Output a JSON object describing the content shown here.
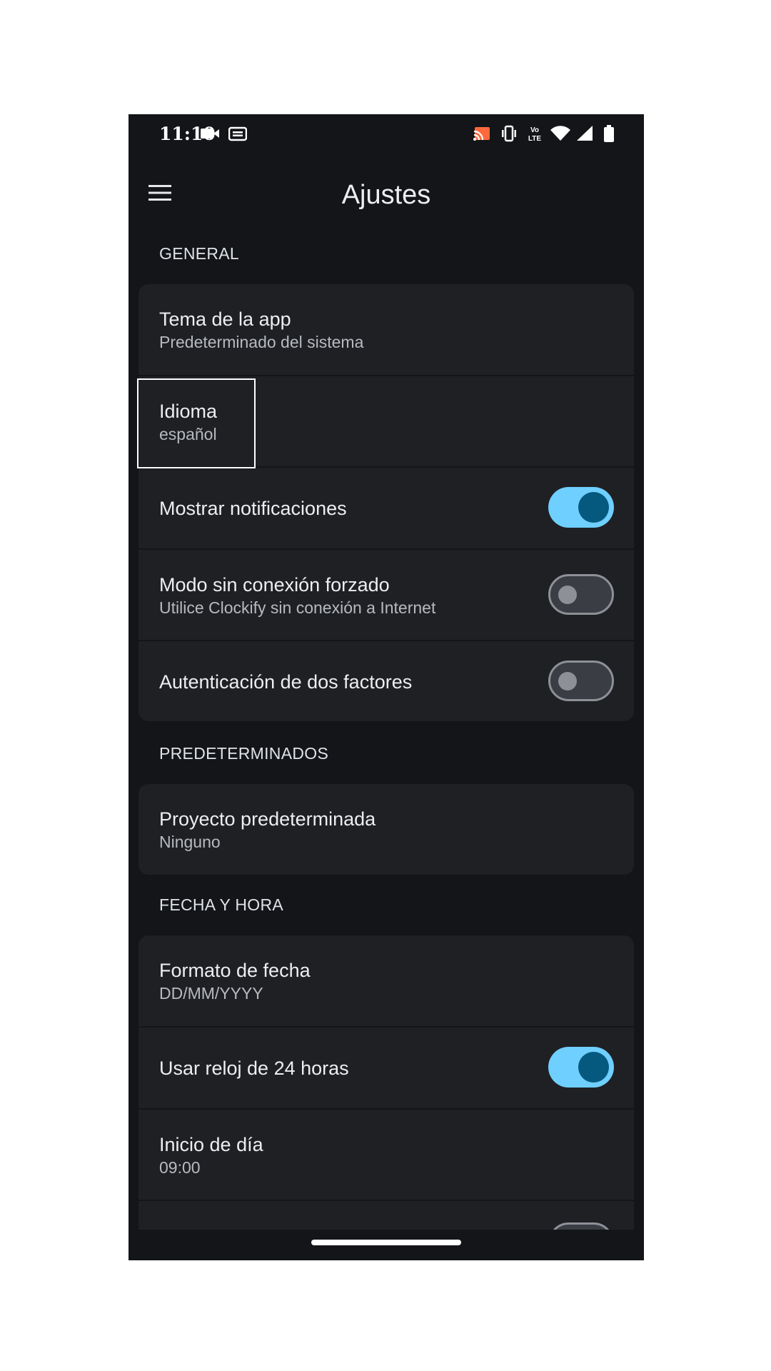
{
  "status_bar": {
    "time": "11:10",
    "icons_left": [
      "video-camera-icon",
      "gif-badge-icon"
    ],
    "icons_right": [
      "cast-icon",
      "vibrate-icon",
      "volte-icon",
      "wifi-icon",
      "cellular-signal-icon",
      "battery-icon"
    ],
    "volte_top": "Vo",
    "volte_bottom": "LTE"
  },
  "app_bar": {
    "menu_icon": "hamburger-menu-icon",
    "title": "Ajustes"
  },
  "sections": {
    "general": "GENERAL",
    "defaults": "PREDETERMINADOS",
    "datetime": "FECHA Y HORA"
  },
  "general": {
    "theme": {
      "title": "Tema de la app",
      "value": "Predeterminado del sistema"
    },
    "language": {
      "title": "Idioma",
      "value": "español"
    },
    "notifications": {
      "title": "Mostrar notificaciones",
      "enabled": true
    },
    "offline": {
      "title": "Modo sin conexión forzado",
      "subtitle": "Utilice Clockify sin conexión a Internet",
      "enabled": false
    },
    "two_factor": {
      "title": "Autenticación de dos factores",
      "enabled": false
    }
  },
  "defaults": {
    "project": {
      "title": "Proyecto predeterminada",
      "value": "Ninguno"
    }
  },
  "datetime": {
    "date_format": {
      "title": "Formato de fecha",
      "value": "DD/MM/YYYY"
    },
    "clock24": {
      "title": "Usar reloj de 24 horas",
      "enabled": true
    },
    "day_start": {
      "title": "Inicio de día",
      "value": "09:00"
    },
    "next_toggle": {
      "enabled": false
    }
  },
  "colors": {
    "background": "#131518",
    "card": "#1f2023",
    "toggle_on_track": "#6fcfff",
    "toggle_on_knob": "#05597e",
    "toggle_off_track": "#3a3d44",
    "toggle_off_border": "#8d9197"
  }
}
